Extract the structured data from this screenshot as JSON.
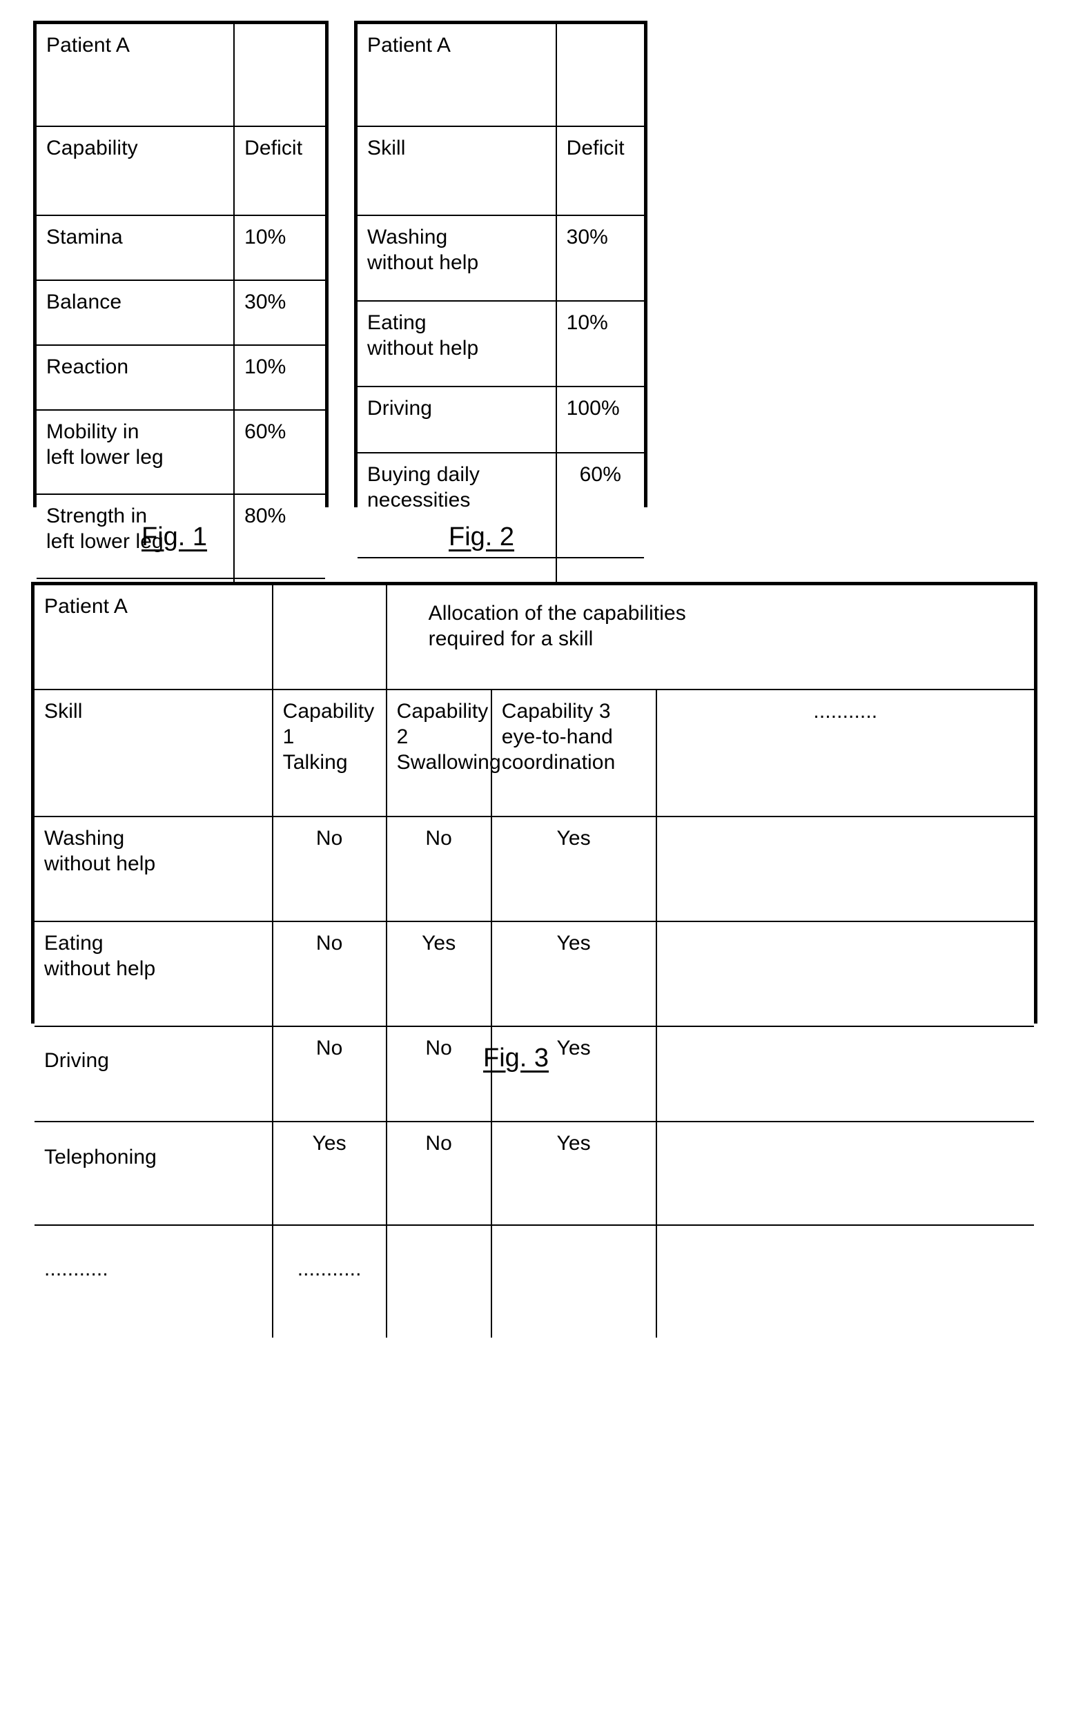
{
  "figures": [
    {
      "id": "fig1",
      "caption": "Fig. 1",
      "title": "Patient A",
      "title_right": "",
      "columns": [
        "Capability",
        "Deficit"
      ],
      "rows": [
        {
          "label": "Stamina",
          "deficit": "10%"
        },
        {
          "label": "Balance",
          "deficit": "30%"
        },
        {
          "label": "Reaction",
          "deficit": "10%"
        },
        {
          "label": "Mobility in\nleft lower leg",
          "deficit": "60%"
        },
        {
          "label": "Strength in\nleft lower leg",
          "deficit": "80%"
        },
        {
          "label": "...........",
          "deficit": ""
        }
      ]
    },
    {
      "id": "fig2",
      "caption": "Fig. 2",
      "title": "Patient A",
      "title_right": "",
      "columns": [
        "Skill",
        "Deficit"
      ],
      "rows": [
        {
          "label": "Washing\nwithout help",
          "deficit": "30%"
        },
        {
          "label": "Eating\nwithout help",
          "deficit": "10%"
        },
        {
          "label": "Driving",
          "deficit": "100%"
        },
        {
          "label": "Buying daily\nnecessities",
          "deficit": "60%"
        },
        {
          "label": "...........",
          "deficit": ""
        }
      ]
    }
  ],
  "fig3": {
    "caption": "Fig. 3",
    "title": "Patient A",
    "title_blank": "",
    "span_header": "Allocation of the capabilities\nrequired for a skill",
    "columns": [
      "Skill",
      "Capability 1\nTalking",
      "Capability 2\nSwallowing",
      "Capability 3\neye-to-hand\ncoordination",
      "..........."
    ],
    "rows": [
      {
        "skill": "Washing\nwithout help",
        "values": [
          "No",
          "No",
          "Yes",
          ""
        ]
      },
      {
        "skill": "Eating\nwithout help",
        "values": [
          "No",
          "Yes",
          "Yes",
          ""
        ]
      },
      {
        "skill": "Driving",
        "values": [
          "No",
          "No",
          "Yes",
          ""
        ]
      },
      {
        "skill": "Telephoning",
        "values": [
          "Yes",
          "No",
          "Yes",
          ""
        ]
      },
      {
        "skill": "...........",
        "values": [
          "...........",
          "",
          "",
          ""
        ]
      }
    ]
  },
  "colors": {
    "ink": "#000000",
    "paper": "#ffffff"
  }
}
